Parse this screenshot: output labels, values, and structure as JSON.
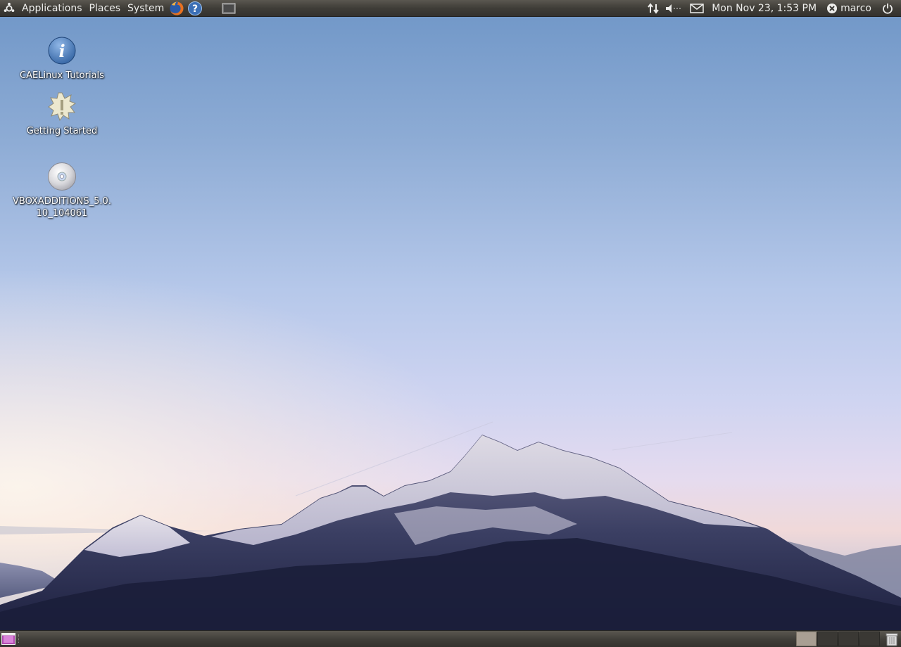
{
  "top_panel": {
    "menus": [
      "Applications",
      "Places",
      "System"
    ],
    "clock": "Mon Nov 23,  1:53 PM",
    "user_name": "marco"
  },
  "desktop": {
    "icons": [
      {
        "label": "CAELinux Tutorials",
        "icon": "info-icon"
      },
      {
        "label": "Getting Started",
        "icon": "starburst-icon"
      },
      {
        "label": "VBOXADDITIONS_5.0.10_104061",
        "icon": "cd-icon"
      }
    ]
  },
  "bottom_panel": {
    "workspace_count": 4,
    "active_workspace": 1
  },
  "colors": {
    "panel_dark": "#3f3d38",
    "ubuntu_orange": "#e95420",
    "help_blue": "#3b6fb6"
  }
}
